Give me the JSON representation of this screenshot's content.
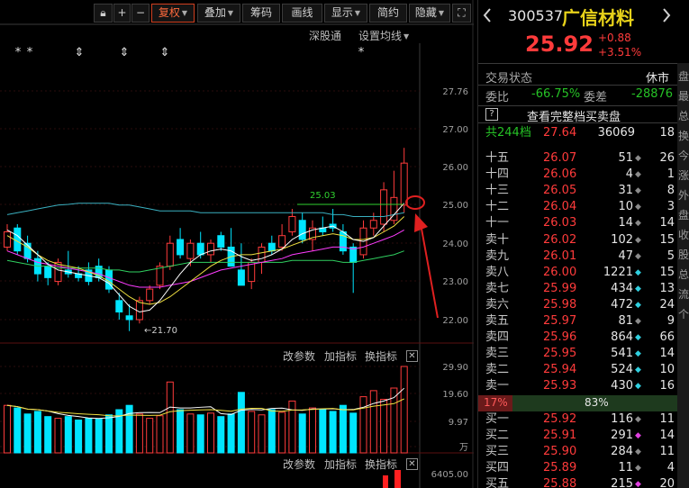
{
  "toolbar": {
    "icons": [
      "lock-icon",
      "plus-icon",
      "minus-icon"
    ],
    "buttons": [
      {
        "label": "复权",
        "active": true
      },
      {
        "label": "叠加",
        "dropdown": true
      },
      {
        "label": "筹码"
      },
      {
        "label": "画线"
      },
      {
        "label": "显示",
        "dropdown": true
      },
      {
        "label": "简约"
      },
      {
        "label": "隐藏",
        "dropdown": true
      }
    ]
  },
  "chart": {
    "sub_links": [
      "深股通",
      "设置均线"
    ],
    "price_axis": [
      "27.76",
      "27.00",
      "26.00",
      "25.00",
      "24.00",
      "23.00",
      "22.00"
    ],
    "annotation_high_line": "25.03",
    "annotation_low": "21.70",
    "event_markers": [
      "*",
      "*",
      "*",
      "*",
      "*",
      "*"
    ],
    "volume_axis": [
      "29.90",
      "19.60",
      "9.97",
      "万"
    ],
    "indicator_links": [
      "改参数",
      "加指标",
      "换指标"
    ],
    "indicator2_value": "6405.00",
    "colors": {
      "up": "#ff3b3b",
      "down": "#00e5ff",
      "ma5": "#ffffff",
      "ma10": "#f0e040",
      "ma20": "#ff3cff",
      "ma60": "#30d060",
      "ma120": "#3ab0c0"
    }
  },
  "quote": {
    "code": "300537",
    "name": "广信材料",
    "price": "25.92",
    "change": "+0.88",
    "change_pct": "+3.51%",
    "status_label": "交易状态",
    "status_value": "休市",
    "weibi_label": "委比",
    "weibi_value": "-66.75%",
    "weicha_label": "委差",
    "weicha_value": "-28876",
    "full_book_label": "查看完整档买卖盘",
    "levels_label": "共244档",
    "levels_price": "27.64",
    "levels_vol": "36069",
    "levels_cnt": "18",
    "sell_rows": [
      {
        "label": "十五",
        "price": "26.07",
        "vol": "51",
        "mark": "◆",
        "mark_color": "#8a8a8a",
        "cnt": "26"
      },
      {
        "label": "十四",
        "price": "26.06",
        "vol": "4",
        "mark": "◆",
        "mark_color": "#8a8a8a",
        "cnt": "1"
      },
      {
        "label": "十三",
        "price": "26.05",
        "vol": "31",
        "mark": "◆",
        "mark_color": "#8a8a8a",
        "cnt": "8"
      },
      {
        "label": "十二",
        "price": "26.04",
        "vol": "10",
        "mark": "◆",
        "mark_color": "#8a8a8a",
        "cnt": "3"
      },
      {
        "label": "十一",
        "price": "26.03",
        "vol": "14",
        "mark": "◆",
        "mark_color": "#8a8a8a",
        "cnt": "14"
      },
      {
        "label": "卖十",
        "price": "26.02",
        "vol": "102",
        "mark": "◆",
        "mark_color": "#8a8a8a",
        "cnt": "15"
      },
      {
        "label": "卖九",
        "price": "26.01",
        "vol": "47",
        "mark": "◆",
        "mark_color": "#8a8a8a",
        "cnt": "5"
      },
      {
        "label": "卖八",
        "price": "26.00",
        "vol": "1221",
        "mark": "◆",
        "mark_color": "#30d0e0",
        "cnt": "15"
      },
      {
        "label": "卖七",
        "price": "25.99",
        "vol": "434",
        "mark": "◆",
        "mark_color": "#30d0e0",
        "cnt": "13"
      },
      {
        "label": "卖六",
        "price": "25.98",
        "vol": "472",
        "mark": "◆",
        "mark_color": "#30d0e0",
        "cnt": "24"
      },
      {
        "label": "卖五",
        "price": "25.97",
        "vol": "81",
        "mark": "◆",
        "mark_color": "#8a8a8a",
        "cnt": "9"
      },
      {
        "label": "卖四",
        "price": "25.96",
        "vol": "864",
        "mark": "◆",
        "mark_color": "#30d0e0",
        "cnt": "66"
      },
      {
        "label": "卖三",
        "price": "25.95",
        "vol": "541",
        "mark": "◆",
        "mark_color": "#30d0e0",
        "cnt": "14"
      },
      {
        "label": "卖二",
        "price": "25.94",
        "vol": "524",
        "mark": "◆",
        "mark_color": "#30d0e0",
        "cnt": "10"
      },
      {
        "label": "卖一",
        "price": "25.93",
        "vol": "430",
        "mark": "◆",
        "mark_color": "#30d0e0",
        "cnt": "16"
      }
    ],
    "ratio_left": "17%",
    "ratio_right": "83%",
    "buy_rows": [
      {
        "label": "买一",
        "price": "25.92",
        "vol": "116",
        "mark": "◆",
        "mark_color": "#8a8a8a",
        "cnt": "11"
      },
      {
        "label": "买二",
        "price": "25.91",
        "vol": "291",
        "mark": "◆",
        "mark_color": "#e040e0",
        "cnt": "14"
      },
      {
        "label": "买三",
        "price": "25.90",
        "vol": "284",
        "mark": "◆",
        "mark_color": "#8a8a8a",
        "cnt": "11"
      },
      {
        "label": "买四",
        "price": "25.89",
        "vol": "11",
        "mark": "◆",
        "mark_color": "#8a8a8a",
        "cnt": "4"
      },
      {
        "label": "买五",
        "price": "25.88",
        "vol": "215",
        "mark": "◆",
        "mark_color": "#e040e0",
        "cnt": "20"
      }
    ],
    "side_tabs": [
      "盘",
      "最",
      "总",
      "换",
      "今",
      "涨",
      "外",
      "盘",
      "收",
      "股",
      "总",
      "流",
      "个"
    ]
  }
}
